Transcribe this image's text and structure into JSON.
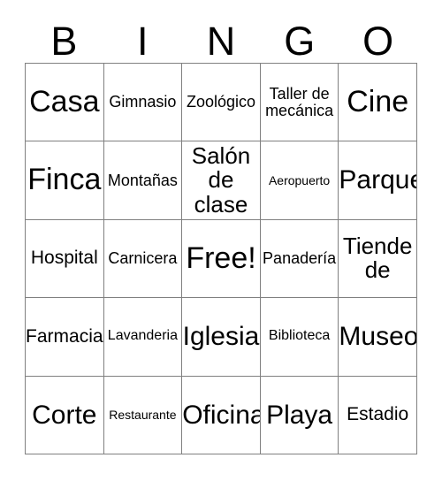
{
  "card": {
    "title_letters": [
      "B",
      "I",
      "N",
      "G",
      "O"
    ],
    "free_space_label": "Free!",
    "border_color": "#808080",
    "text_color": "#000000",
    "background_color": "#ffffff",
    "rows": 5,
    "columns": 5,
    "cells": [
      [
        {
          "label": "Casa",
          "size": "fs-xxl"
        },
        {
          "label": "Gimnasio",
          "size": "fs-sm"
        },
        {
          "label": "Zoológico",
          "size": "fs-sm"
        },
        {
          "label": "Taller de mecánica",
          "size": "fs-sm"
        },
        {
          "label": "Cine",
          "size": "fs-xxl"
        }
      ],
      [
        {
          "label": "Finca",
          "size": "fs-xxl"
        },
        {
          "label": "Montañas",
          "size": "fs-sm"
        },
        {
          "label": "Salón de clase",
          "size": "fs-lg"
        },
        {
          "label": "Aeropuerto",
          "size": "fs-xxs"
        },
        {
          "label": "Parque",
          "size": "fs-xl"
        }
      ],
      [
        {
          "label": "Hospital",
          "size": "fs-md"
        },
        {
          "label": "Carnicera",
          "size": "fs-sm"
        },
        {
          "label": "Free!",
          "size": "fs-xxl"
        },
        {
          "label": "Panadería",
          "size": "fs-sm"
        },
        {
          "label": "Tiende de",
          "size": "fs-lg"
        }
      ],
      [
        {
          "label": "Farmacia",
          "size": "fs-md"
        },
        {
          "label": "Lavanderia",
          "size": "fs-xs"
        },
        {
          "label": "Iglesia",
          "size": "fs-xl"
        },
        {
          "label": "Biblioteca",
          "size": "fs-xs"
        },
        {
          "label": "Museo",
          "size": "fs-xl"
        }
      ],
      [
        {
          "label": "Corte",
          "size": "fs-xl"
        },
        {
          "label": "Restaurante",
          "size": "fs-xxs"
        },
        {
          "label": "Oficina",
          "size": "fs-xl"
        },
        {
          "label": "Playa",
          "size": "fs-xl"
        },
        {
          "label": "Estadio",
          "size": "fs-md"
        }
      ]
    ]
  }
}
